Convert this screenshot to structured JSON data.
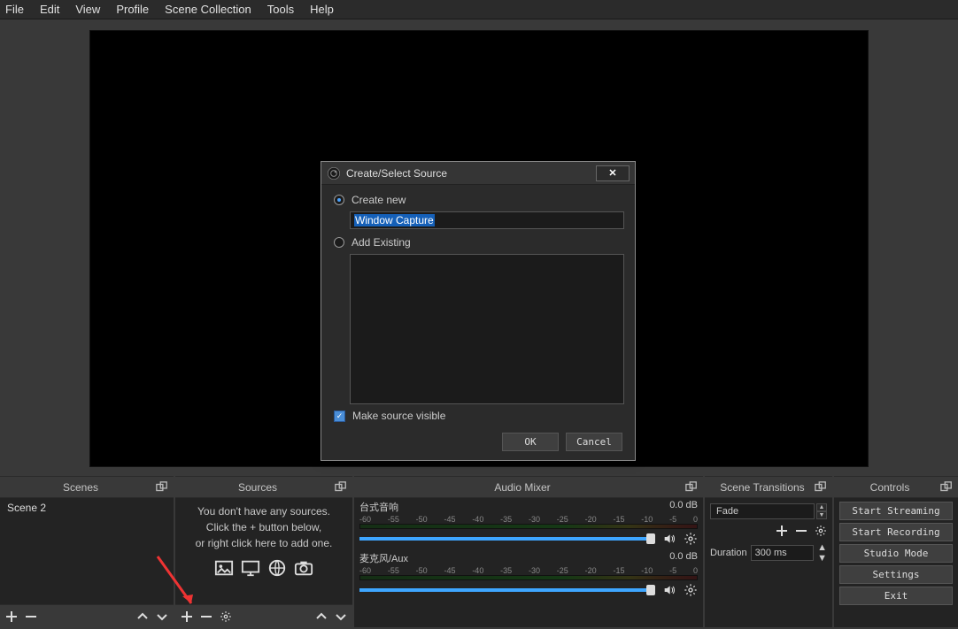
{
  "menu": {
    "file": "File",
    "edit": "Edit",
    "view": "View",
    "profile": "Profile",
    "scene_collection": "Scene Collection",
    "tools": "Tools",
    "help": "Help"
  },
  "panels": {
    "scenes": {
      "title": "Scenes",
      "items": [
        "Scene 2"
      ]
    },
    "sources": {
      "title": "Sources",
      "empty_line1": "You don't have any sources.",
      "empty_line2": "Click the + button below,",
      "empty_line3": "or right click here to add one."
    },
    "mixer": {
      "title": "Audio Mixer",
      "channels": [
        {
          "name": "台式音响",
          "level": "0.0 dB"
        },
        {
          "name": "麦克风/Aux",
          "level": "0.0 dB"
        }
      ],
      "scale": [
        "-60",
        "-55",
        "-50",
        "-45",
        "-40",
        "-35",
        "-30",
        "-25",
        "-20",
        "-15",
        "-10",
        "-5",
        "0"
      ]
    },
    "transitions": {
      "title": "Scene Transitions",
      "selected": "Fade",
      "duration_label": "Duration",
      "duration_value": "300 ms"
    },
    "controls": {
      "title": "Controls",
      "buttons": [
        "Start Streaming",
        "Start Recording",
        "Studio Mode",
        "Settings",
        "Exit"
      ]
    }
  },
  "dialog": {
    "title": "Create/Select Source",
    "create_new": "Create new",
    "input_value": "Window Capture",
    "add_existing": "Add Existing",
    "make_visible": "Make source visible",
    "ok": "OK",
    "cancel": "Cancel"
  }
}
